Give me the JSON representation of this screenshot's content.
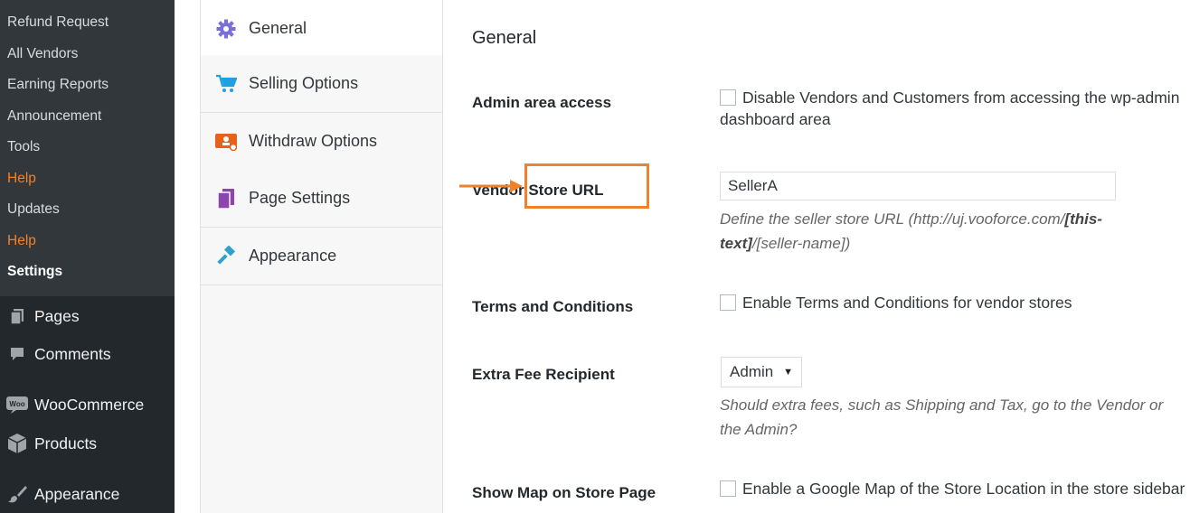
{
  "sidebar": {
    "submenu": [
      {
        "label": "Refund Request"
      },
      {
        "label": "All Vendors"
      },
      {
        "label": "Earning Reports"
      },
      {
        "label": "Announcement"
      },
      {
        "label": "Tools"
      },
      {
        "label": "Help"
      },
      {
        "label": "Updates"
      },
      {
        "label": "Help"
      },
      {
        "label": "Settings"
      }
    ],
    "menu": [
      {
        "label": "Pages",
        "icon": "pages-icon"
      },
      {
        "label": "Comments",
        "icon": "comments-icon"
      },
      {
        "label": "WooCommerce",
        "icon": "woocommerce-icon"
      },
      {
        "label": "Products",
        "icon": "products-box-icon"
      },
      {
        "label": "Appearance",
        "icon": "paintbrush-icon"
      }
    ]
  },
  "settings_nav": {
    "tabs": [
      {
        "label": "General",
        "icon": "gear-icon",
        "active": true
      },
      {
        "label": "Selling Options",
        "icon": "cart-icon"
      },
      {
        "label": "Withdraw Options",
        "icon": "withdraw-icon"
      },
      {
        "label": "Page Settings",
        "icon": "pages-icon"
      },
      {
        "label": "Appearance",
        "icon": "hammer-icon"
      }
    ]
  },
  "form": {
    "section_title": "General",
    "admin_access": {
      "label": "Admin area access",
      "checkbox_label": "Disable Vendors and Customers from accessing the wp-admin dashboard area",
      "checked": false
    },
    "store_url": {
      "label": "Vendor Store URL",
      "value": "SellerA",
      "desc_prefix": "Define the seller store URL (http://uj.vooforce.com/",
      "desc_bold": "[this-text]",
      "desc_suffix": "/[seller-name])"
    },
    "terms": {
      "label": "Terms and Conditions",
      "checkbox_label": "Enable Terms and Conditions for vendor stores",
      "checked": false
    },
    "extra_fee": {
      "label": "Extra Fee Recipient",
      "selected": "Admin",
      "arrow": "▼",
      "description": "Should extra fees, such as Shipping and Tax, go to the Vendor or the Admin?"
    },
    "store_map": {
      "label": "Show Map on Store Page",
      "checkbox_label": "Enable a Google Map of the Store Location in the store sidebar",
      "checked": false
    }
  },
  "colors": {
    "sidebar_bg": "#23282d",
    "submenu_bg": "#32373c",
    "accent_orange": "#f0822c",
    "tab_icon_blue": "#2ea2cc",
    "gear_icon": "#7b6fd6",
    "withdraw_icon": "#e8601c",
    "pages_icon": "#8e44ad"
  }
}
